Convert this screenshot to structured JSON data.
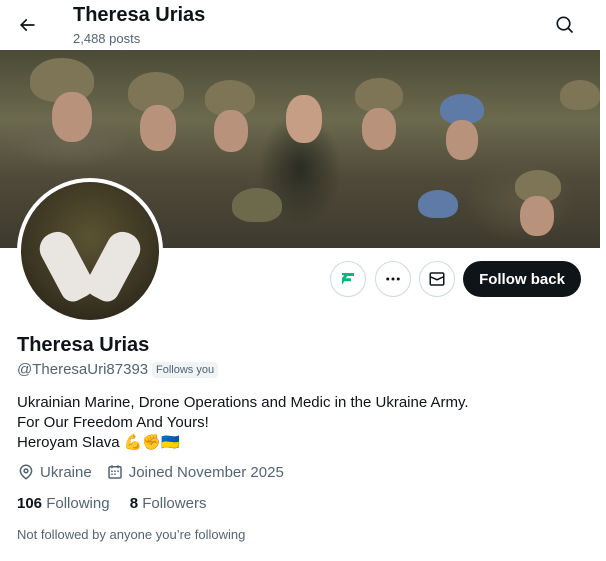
{
  "header": {
    "title": "Theresa Urias",
    "posts_count": "2,488 posts"
  },
  "profile": {
    "name": "Theresa Urias",
    "handle": "@TheresaUri87393",
    "follows_you_badge": "Follows you",
    "bio_line1": "Ukrainian Marine, Drone Operations and Medic in the Ukraine Army.",
    "bio_line2": "For Our Freedom And Yours!",
    "bio_line3": "Heroyam Slava",
    "bio_emojis": "💪✊🇺🇦",
    "location": "Ukraine",
    "joined": "Joined November 2025",
    "following_count": "106",
    "following_label": "Following",
    "followers_count": "8",
    "followers_label": "Followers",
    "not_followed_text": "Not followed by anyone you’re following"
  },
  "actions": {
    "follow_back_label": "Follow back"
  },
  "icons": {
    "back": "arrow-left-icon",
    "search": "search-icon",
    "grok": "grok-icon",
    "more": "more-icon",
    "message": "envelope-icon",
    "location": "location-pin-icon",
    "calendar": "calendar-icon"
  },
  "colors": {
    "accent": "#0f1419",
    "secondary_text": "#536471",
    "border": "#cfd9de",
    "grok_green": "#00ba7c"
  }
}
